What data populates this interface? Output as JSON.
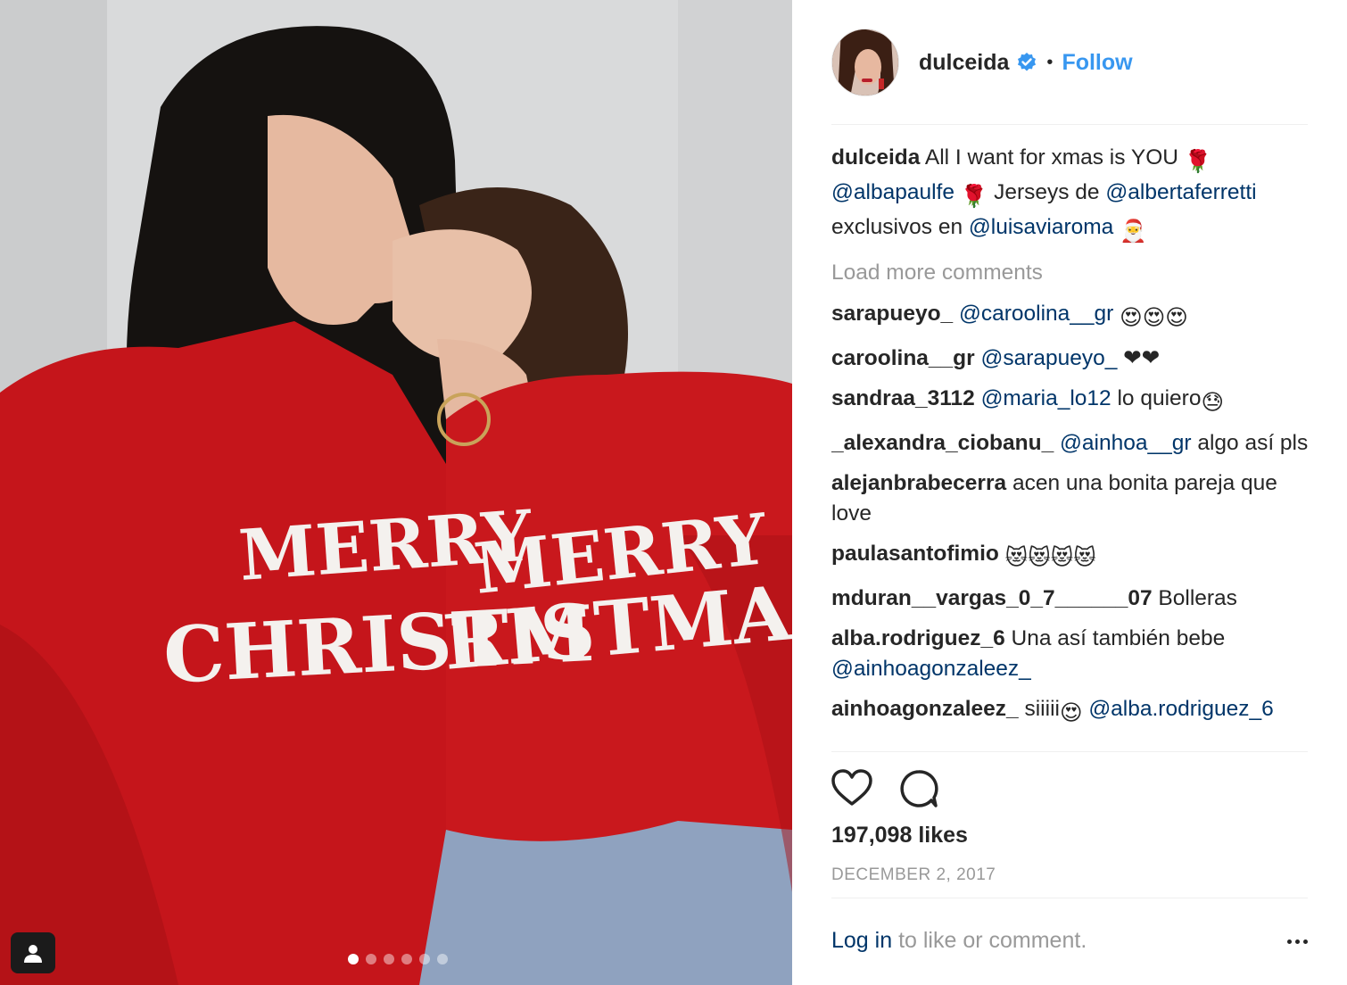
{
  "post": {
    "username": "dulceida",
    "follow_label": "Follow",
    "separator": "•",
    "caption": {
      "username": "dulceida",
      "text1": "All I want for xmas is YOU",
      "mention1": "@albapaulfe",
      "text2": "Jerseys de",
      "mention2": "@albertaferretti",
      "text3": "exclusivos en",
      "mention3": "@luisaviaroma"
    },
    "load_more": "Load more comments",
    "comments": [
      {
        "username": "sarapueyo_",
        "mention": "@caroolina__gr",
        "text": "",
        "emoji": "😍😍😍"
      },
      {
        "username": "caroolina__gr",
        "mention": "@sarapueyo_",
        "text": "",
        "emoji": "❤❤"
      },
      {
        "username": "sandraa_3112",
        "mention": "@maria_lo12",
        "text": "lo quiero",
        "emoji": "😓"
      },
      {
        "username": "_alexandra_ciobanu_",
        "mention": "@ainhoa__gr",
        "text": "algo así pls",
        "emoji": ""
      },
      {
        "username": "alejanbrabecerra",
        "mention": "",
        "text": "acen una bonita pareja que love",
        "emoji": ""
      },
      {
        "username": "paulasantofimio",
        "mention": "",
        "text": "",
        "emoji": "😻😻😻😻"
      },
      {
        "username": "mduran__vargas_0_7______07",
        "mention": "",
        "text": "Bolleras",
        "emoji": ""
      },
      {
        "username": "alba.rodriguez_6",
        "mention": "",
        "text": "Una así también bebe",
        "mention_after": "@ainhoagonzaleez_",
        "emoji": ""
      },
      {
        "username": "ainhoagonzaleez_",
        "mention": "",
        "text": "siiiii",
        "emoji": "😍",
        "mention_after": "@alba.rodriguez_6"
      }
    ],
    "likes": "197,098 likes",
    "date": "DECEMBER 2, 2017",
    "login_link": "Log in",
    "login_text": "to like or comment.",
    "photo": {
      "sweater_text_line1": "MERRY",
      "sweater_text_line2": "CHRISTMAS",
      "carousel_dots": 6,
      "active_dot": 0
    }
  },
  "colors": {
    "link": "#3897f0",
    "mention": "#003569",
    "muted": "#999999",
    "text": "#262626",
    "sweater": "#c8141a"
  },
  "icons": [
    "verified-badge-icon",
    "heart-icon",
    "comment-icon",
    "more-options-icon",
    "user-tag-icon"
  ]
}
